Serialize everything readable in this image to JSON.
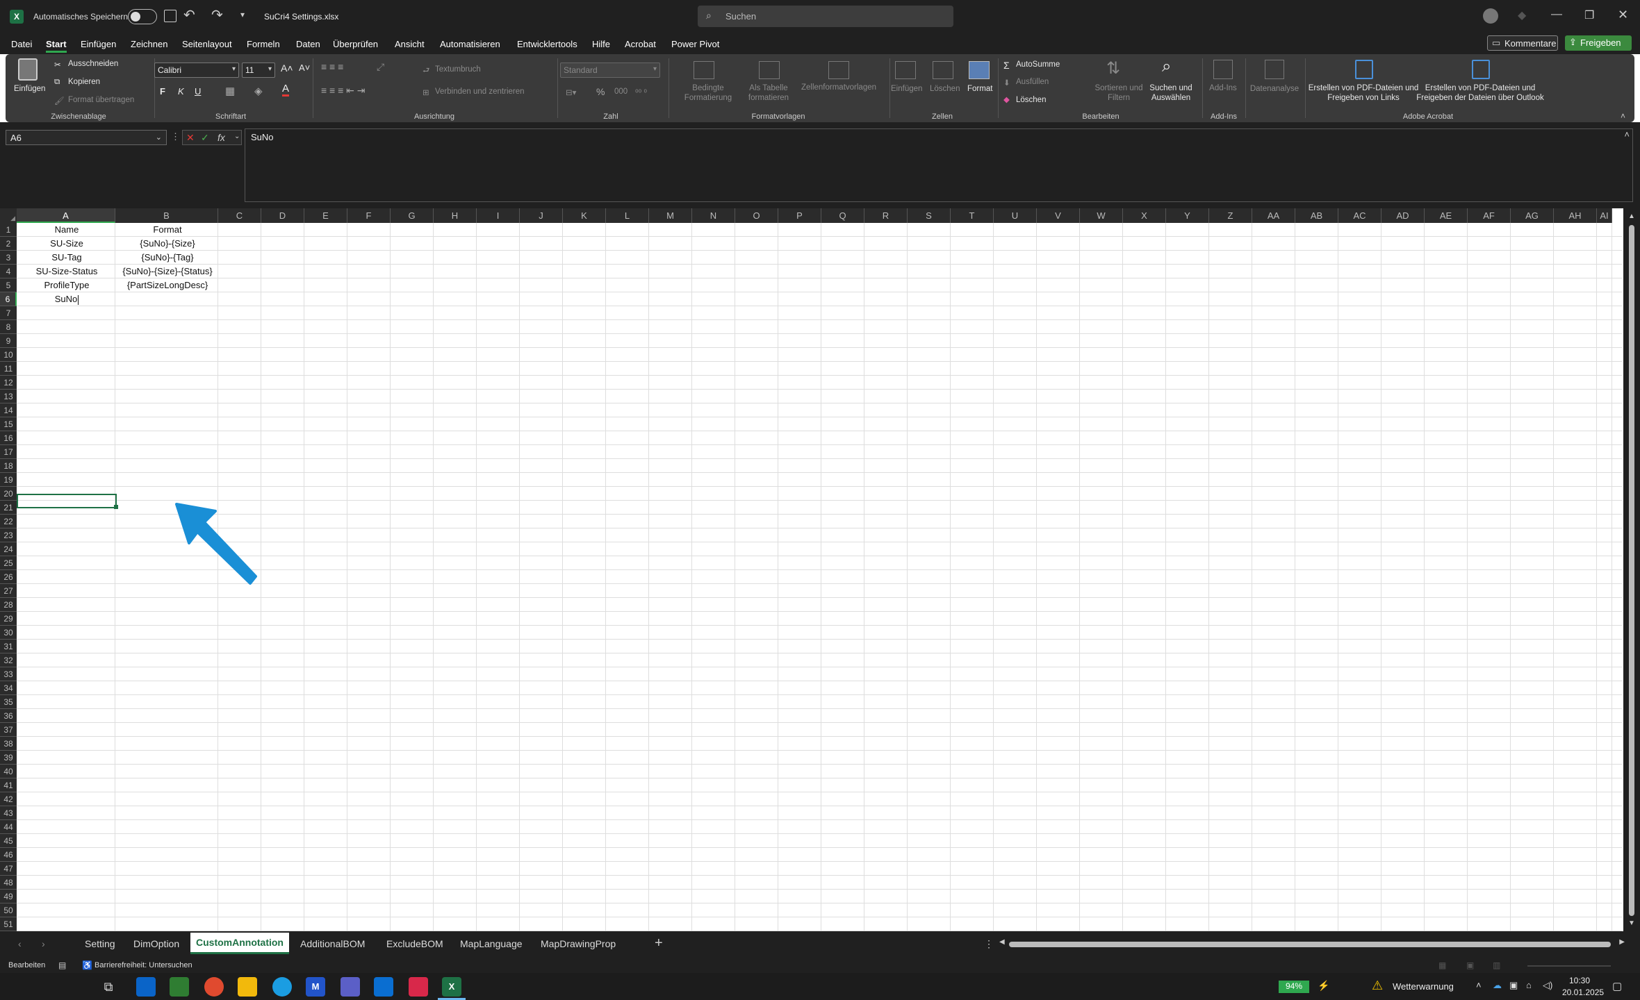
{
  "titlebar": {
    "autosave_label": "Automatisches Speichern",
    "filename": "SuCri4 Settings.xlsx",
    "search_placeholder": "Suchen"
  },
  "menu": [
    "Datei",
    "Start",
    "Einfügen",
    "Zeichnen",
    "Seitenlayout",
    "Formeln",
    "Daten",
    "Überprüfen",
    "Ansicht",
    "Automatisieren",
    "Entwicklertools",
    "Hilfe",
    "Acrobat",
    "Power Pivot"
  ],
  "menu_active": "Start",
  "comments_label": "Kommentare",
  "share_label": "Freigeben",
  "ribbon": {
    "clipboard": {
      "paste": "Einfügen",
      "cut": "Ausschneiden",
      "copy": "Kopieren",
      "format_painter": "Format übertragen",
      "group": "Zwischenablage"
    },
    "font": {
      "name": "Calibri",
      "size": "11",
      "bold": "F",
      "italic": "K",
      "underline": "U",
      "group": "Schriftart"
    },
    "alignment": {
      "wrap": "Textumbruch",
      "merge": "Verbinden und zentrieren",
      "group": "Ausrichtung"
    },
    "number": {
      "format": "Standard",
      "percent": "%",
      "group": "Zahl"
    },
    "styles": {
      "conditional": "Bedingte Formatierung",
      "table": "Als Tabelle formatieren",
      "cellstyles": "Zellenformatvorlagen",
      "group": "Formatvorlagen"
    },
    "cells": {
      "insert": "Einfügen",
      "delete": "Löschen",
      "format": "Format",
      "group": "Zellen"
    },
    "editing": {
      "autosum": "AutoSumme",
      "fill": "Ausfüllen",
      "clear": "Löschen",
      "sort": "Sortieren und Filtern",
      "find": "Suchen und Auswählen",
      "group": "Bearbeiten"
    },
    "addins": {
      "addins": "Add-Ins",
      "group": "Add-Ins"
    },
    "analysis": {
      "label": "Datenanalyse"
    },
    "acrobat": {
      "pdf_links": "Erstellen von PDF-Dateien und Freigeben von Links",
      "pdf_outlook": "Erstellen von PDF-Dateien und Freigeben der Dateien über Outlook",
      "group": "Adobe Acrobat"
    }
  },
  "formula_bar": {
    "name_box": "A6",
    "content": "SuNo",
    "fx": "fx"
  },
  "columns": [
    "A",
    "B",
    "C",
    "D",
    "E",
    "F",
    "G",
    "H",
    "I",
    "J",
    "K",
    "L",
    "M",
    "N",
    "O",
    "P",
    "Q",
    "R",
    "S",
    "T",
    "U",
    "V",
    "W",
    "X",
    "Y",
    "Z",
    "AA",
    "AB",
    "AC",
    "AD",
    "AE",
    "AF",
    "AG",
    "AH",
    "AI"
  ],
  "rows": [
    "1",
    "2",
    "3",
    "4",
    "5",
    "6",
    "7",
    "8",
    "9",
    "10",
    "11",
    "12",
    "13",
    "14",
    "15",
    "16",
    "17",
    "18",
    "19",
    "20",
    "21",
    "22",
    "23",
    "24",
    "25",
    "26",
    "27",
    "28",
    "29",
    "30",
    "31",
    "32",
    "33",
    "34",
    "35",
    "36",
    "37",
    "38",
    "39",
    "40",
    "41",
    "42",
    "43",
    "44",
    "45",
    "46",
    "47",
    "48",
    "49",
    "50",
    "51"
  ],
  "cells": {
    "A": [
      "Name",
      "SU-Size",
      "SU-Tag",
      "SU-Size-Status",
      "ProfileType",
      "SuNo"
    ],
    "B": [
      "Format",
      "{SuNo}-{Size}",
      "{SuNo}-{Tag}",
      "{SuNo}-{Size}-{Status}",
      "{PartSizeLongDesc}",
      ""
    ]
  },
  "sheet_tabs": [
    "Setting",
    "DimOption",
    "CustomAnnotation",
    "AdditionalBOM",
    "ExcludeBOM",
    "MapLanguage",
    "MapDrawingProp"
  ],
  "active_tab": "CustomAnnotation",
  "statusbar": {
    "mode": "Bearbeiten",
    "accessibility": "Barrierefreiheit: Untersuchen"
  },
  "taskbar": {
    "battery": "94%",
    "weather": "Wetterwarnung",
    "time": "10:30",
    "date": "20.01.2025"
  },
  "colors": {
    "accent_green": "#1e7145",
    "annotation_arrow": "#1a8fd6",
    "share_button": "#3b8a3e"
  }
}
